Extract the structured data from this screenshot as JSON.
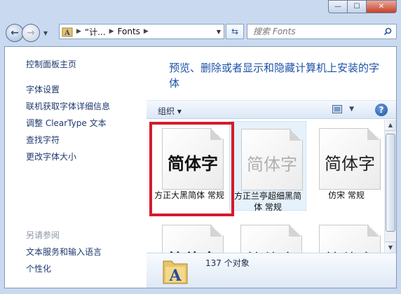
{
  "window": {
    "minimize_glyph": "—",
    "maximize_glyph": "☐",
    "close_glyph": "✕"
  },
  "nav": {
    "address_crumbs": [
      "“计...",
      "Fonts"
    ],
    "search_placeholder": "搜索 Fonts"
  },
  "sidebar": {
    "home": "控制面板主页",
    "links": [
      "字体设置",
      "联机获取字体详细信息",
      "调整 ClearType 文本",
      "查找字符",
      "更改字体大小"
    ],
    "see_also_title": "另请参阅",
    "see_also": [
      "文本服务和输入语言",
      "个性化"
    ]
  },
  "main": {
    "heading": "预览、删除或者显示和隐藏计算机上安装的字体",
    "toolbar": {
      "organize": "组织 ▾"
    },
    "fonts": [
      {
        "sample": "简体字",
        "name": "方正大黑简体 常规",
        "style": "bold"
      },
      {
        "sample": "简体字",
        "name": "方正兰亭超细黑简体 常规",
        "style": "thin"
      },
      {
        "sample": "简体字",
        "name": "仿宋 常规",
        "style": "song"
      },
      {
        "sample": "简体字",
        "name": "",
        "style": "bold"
      },
      {
        "sample": "简体字",
        "name": "",
        "style": "song"
      },
      {
        "sample": "简体字",
        "name": "",
        "style": "song"
      }
    ],
    "status": "137 个对象"
  },
  "colors": {
    "highlight_box": "#d41b2c",
    "heading": "#1c52a8",
    "link": "#1e3a6e"
  }
}
